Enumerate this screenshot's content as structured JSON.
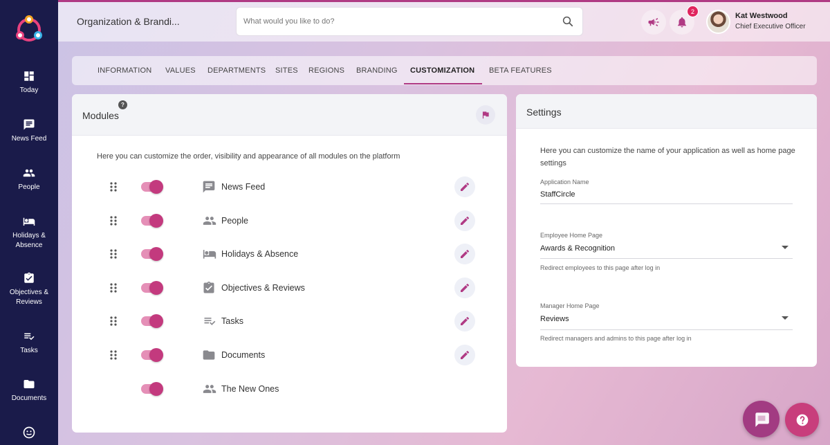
{
  "app": {
    "accent_color": "#b03a84",
    "sidebar_color": "#1a1b4a"
  },
  "sidebar": {
    "items": [
      {
        "label": "Today",
        "icon": "dashboard-icon"
      },
      {
        "label": "News Feed",
        "icon": "message-icon"
      },
      {
        "label": "People",
        "icon": "people-icon"
      },
      {
        "label": "Holidays & Absence",
        "icon": "bed-icon"
      },
      {
        "label": "Objectives & Reviews",
        "icon": "clipboard-check-icon"
      },
      {
        "label": "Tasks",
        "icon": "checklist-icon"
      },
      {
        "label": "Documents",
        "icon": "folder-icon"
      },
      {
        "label": "",
        "icon": "smiley-icon"
      }
    ]
  },
  "header": {
    "page_title": "Organization & Brandi...",
    "search_placeholder": "What would you like to do?",
    "notification_count": "2",
    "user": {
      "name": "Kat Westwood",
      "role": "Chief Executive Officer"
    }
  },
  "tabs": [
    {
      "label": "INFORMATION",
      "active": false
    },
    {
      "label": "VALUES",
      "active": false
    },
    {
      "label": "DEPARTMENTS",
      "active": false
    },
    {
      "label": "SITES",
      "active": false
    },
    {
      "label": "REGIONS",
      "active": false
    },
    {
      "label": "BRANDING",
      "active": false
    },
    {
      "label": "CUSTOMIZATION",
      "active": true
    },
    {
      "label": "BETA FEATURES",
      "active": false
    }
  ],
  "modules": {
    "title": "Modules",
    "help": "?",
    "intro": "Here you can customize the order, visibility and appearance of all modules on the platform",
    "items": [
      {
        "label": "News Feed",
        "icon": "message-icon",
        "enabled": true,
        "editable": true
      },
      {
        "label": "People",
        "icon": "people-icon",
        "enabled": true,
        "editable": true
      },
      {
        "label": "Holidays & Absence",
        "icon": "bed-icon",
        "enabled": true,
        "editable": true
      },
      {
        "label": "Objectives & Reviews",
        "icon": "clipboard-check-icon",
        "enabled": true,
        "editable": true
      },
      {
        "label": "Tasks",
        "icon": "checklist-icon",
        "enabled": true,
        "editable": true
      },
      {
        "label": "Documents",
        "icon": "folder-icon",
        "enabled": true,
        "editable": true
      },
      {
        "label": "The New Ones",
        "icon": "people-icon",
        "enabled": true,
        "editable": false
      }
    ]
  },
  "settings": {
    "title": "Settings",
    "intro": "Here you can customize the name of your application as well as home page settings",
    "app_name_label": "Application Name",
    "app_name_value": "StaffCircle",
    "employee_home_label": "Employee Home Page",
    "employee_home_value": "Awards & Recognition",
    "employee_home_help": "Redirect employees to this page after log in",
    "manager_home_label": "Manager Home Page",
    "manager_home_value": "Reviews",
    "manager_home_help": "Redirect managers and admins to this page after log in"
  }
}
